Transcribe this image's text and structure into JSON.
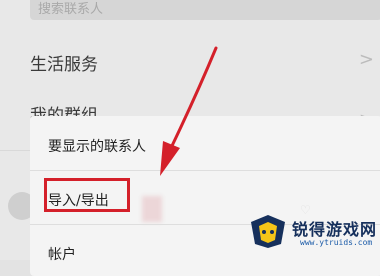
{
  "search": {
    "placeholder": "搜索联系人"
  },
  "background_list": {
    "items": [
      {
        "label": "生活服务",
        "chevron": ">"
      },
      {
        "label": "我的群组",
        "chevron": ">"
      }
    ]
  },
  "popup_menu": {
    "items": [
      {
        "label": "要显示的联系人"
      },
      {
        "label": "导入/导出"
      },
      {
        "label": "帐户"
      }
    ]
  },
  "annotation": {
    "highlight_color": "#d4202a",
    "arrow_color": "#d4202a",
    "highlighted_item": "导入/导出"
  },
  "watermark": {
    "title": "锐得游戏网",
    "url": "www.ytruids.com",
    "brand_color": "#16305c"
  }
}
